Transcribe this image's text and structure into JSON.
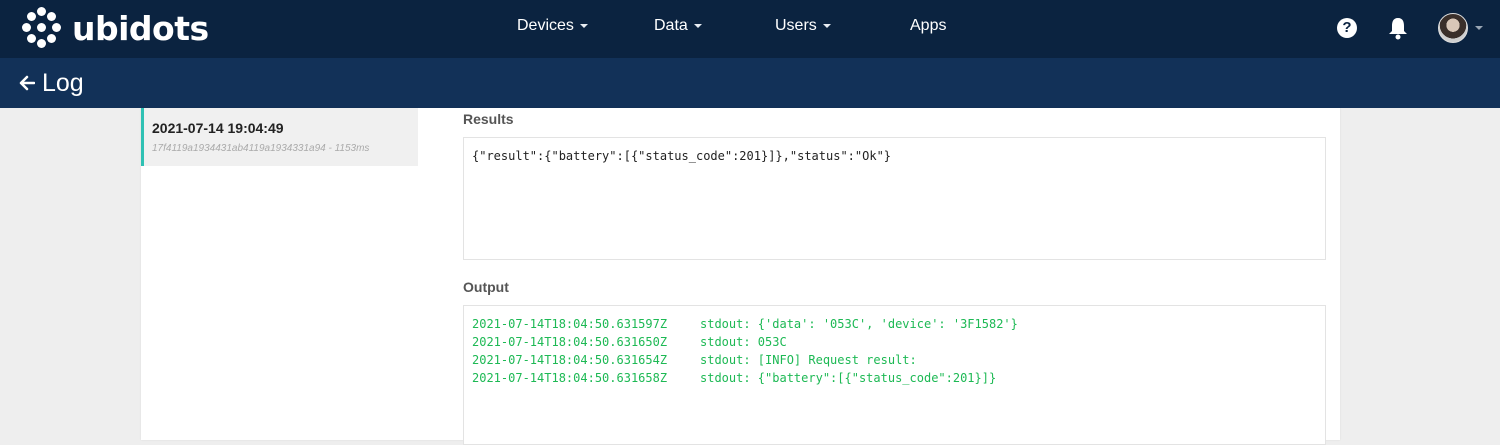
{
  "brand": {
    "name": "ubidots"
  },
  "nav": {
    "items": [
      {
        "label": "Devices",
        "has_dropdown": true
      },
      {
        "label": "Data",
        "has_dropdown": true
      },
      {
        "label": "Users",
        "has_dropdown": true
      },
      {
        "label": "Apps",
        "has_dropdown": false
      }
    ],
    "icons": [
      "help-icon",
      "bell-icon",
      "avatar"
    ]
  },
  "subheader": {
    "title": "Log",
    "back_icon": "arrow-left-icon"
  },
  "log_list": {
    "items": [
      {
        "date": "2021-07-14 19:04:49",
        "meta": "17f4119a1934431ab4119a1934331a94 - 1153ms",
        "selected": true
      }
    ]
  },
  "results": {
    "label": "Results",
    "content": "{\"result\":{\"battery\":[{\"status_code\":201}]},\"status\":\"Ok\"}"
  },
  "output": {
    "label": "Output",
    "lines": [
      {
        "ts": "2021-07-14T18:04:50.631597Z",
        "msg": "stdout: {'data': '053C', 'device': '3F1582'}"
      },
      {
        "ts": "2021-07-14T18:04:50.631650Z",
        "msg": "stdout: 053C"
      },
      {
        "ts": "2021-07-14T18:04:50.631654Z",
        "msg": "stdout: [INFO] Request result:"
      },
      {
        "ts": "2021-07-14T18:04:50.631658Z",
        "msg": "stdout: {\"battery\":[{\"status_code\":201}]}"
      }
    ]
  },
  "colors": {
    "nav_bg": "#0b2340",
    "subheader_bg": "#123158",
    "accent": "#2fc1b4",
    "output_text": "#1db954"
  }
}
